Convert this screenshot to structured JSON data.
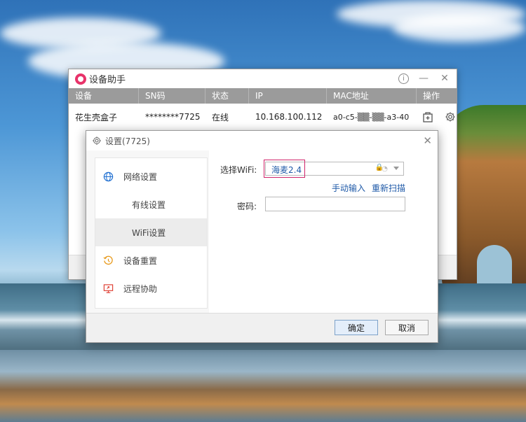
{
  "main_window": {
    "title": "设备助手",
    "columns": [
      "设备",
      "SN码",
      "状态",
      "IP",
      "MAC地址",
      "操作"
    ],
    "rows": [
      {
        "device": "花生壳盒子",
        "sn": "********7725",
        "status": "在线",
        "ip": "10.168.100.112",
        "mac": "a0-c5-▒▒-▒▒-a3-40"
      }
    ]
  },
  "dialog": {
    "title": "设置(7725)",
    "sidebar": {
      "network": "网络设置",
      "wired": "有线设置",
      "wifi": "WiFi设置",
      "reset": "设备重置",
      "remote": "远程协助"
    },
    "select_wifi_label": "选择WiFi:",
    "wifi_value": "海麦2.4",
    "manual_input": "手动输入",
    "rescan": "重新扫描",
    "password_label": "密码:",
    "ok": "确定",
    "cancel": "取消"
  },
  "colors": {
    "accent": "#1f5aa8",
    "highlight": "#d0246a",
    "header_bg": "#9b9b9b"
  }
}
